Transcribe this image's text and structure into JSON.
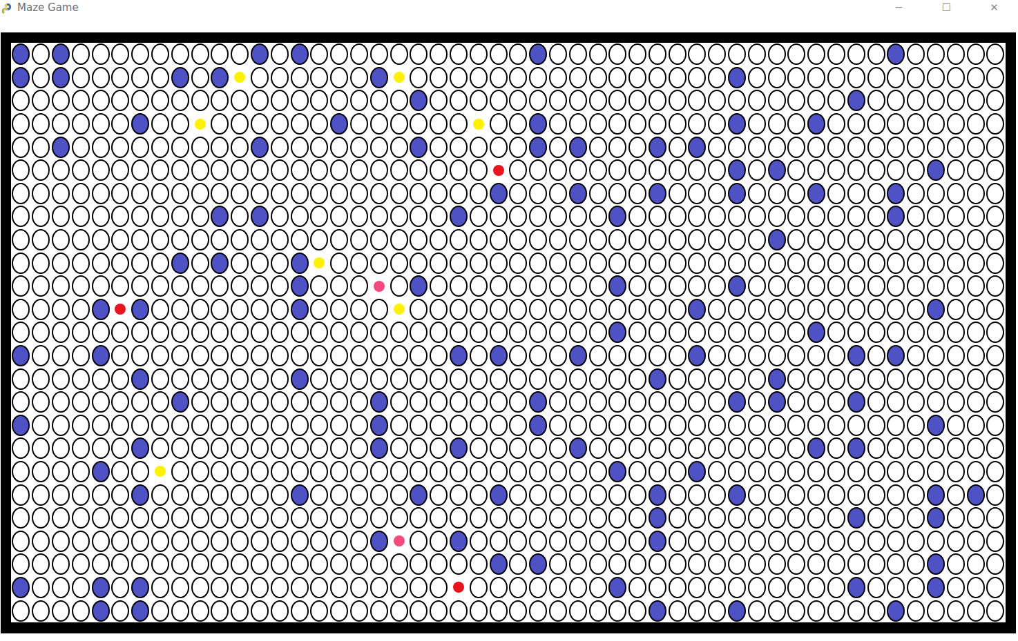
{
  "window": {
    "title": "Maze Game",
    "controls": [
      "─",
      "☐",
      "✕"
    ]
  },
  "grid": {
    "rows": 25,
    "columns": 50
  },
  "walls": [
    [
      0,
      0
    ],
    [
      0,
      2
    ],
    [
      0,
      12
    ],
    [
      0,
      14
    ],
    [
      0,
      26
    ],
    [
      0,
      44
    ],
    [
      1,
      0
    ],
    [
      1,
      2
    ],
    [
      1,
      8
    ],
    [
      1,
      10
    ],
    [
      1,
      18
    ],
    [
      1,
      36
    ],
    [
      2,
      20
    ],
    [
      2,
      42
    ],
    [
      3,
      6
    ],
    [
      3,
      16
    ],
    [
      3,
      26
    ],
    [
      3,
      36
    ],
    [
      3,
      40
    ],
    [
      4,
      2
    ],
    [
      4,
      12
    ],
    [
      4,
      20
    ],
    [
      4,
      26
    ],
    [
      4,
      28
    ],
    [
      4,
      32
    ],
    [
      4,
      34
    ],
    [
      5,
      36
    ],
    [
      5,
      38
    ],
    [
      5,
      46
    ],
    [
      6,
      24
    ],
    [
      6,
      28
    ],
    [
      6,
      32
    ],
    [
      6,
      36
    ],
    [
      6,
      40
    ],
    [
      6,
      44
    ],
    [
      7,
      10
    ],
    [
      7,
      12
    ],
    [
      7,
      22
    ],
    [
      7,
      30
    ],
    [
      7,
      44
    ],
    [
      8,
      38
    ],
    [
      9,
      8
    ],
    [
      9,
      10
    ],
    [
      9,
      14
    ],
    [
      10,
      14
    ],
    [
      10,
      20
    ],
    [
      10,
      30
    ],
    [
      10,
      36
    ],
    [
      11,
      4
    ],
    [
      11,
      6
    ],
    [
      11,
      14
    ],
    [
      11,
      34
    ],
    [
      11,
      46
    ],
    [
      12,
      30
    ],
    [
      12,
      40
    ],
    [
      13,
      0
    ],
    [
      13,
      4
    ],
    [
      13,
      22
    ],
    [
      13,
      24
    ],
    [
      13,
      28
    ],
    [
      13,
      34
    ],
    [
      13,
      42
    ],
    [
      13,
      44
    ],
    [
      14,
      6
    ],
    [
      14,
      14
    ],
    [
      14,
      32
    ],
    [
      14,
      38
    ],
    [
      15,
      8
    ],
    [
      15,
      18
    ],
    [
      15,
      26
    ],
    [
      15,
      36
    ],
    [
      15,
      38
    ],
    [
      15,
      42
    ],
    [
      16,
      0
    ],
    [
      16,
      18
    ],
    [
      16,
      26
    ],
    [
      16,
      46
    ],
    [
      17,
      6
    ],
    [
      17,
      18
    ],
    [
      17,
      22
    ],
    [
      17,
      28
    ],
    [
      17,
      40
    ],
    [
      17,
      42
    ],
    [
      18,
      4
    ],
    [
      18,
      30
    ],
    [
      18,
      34
    ],
    [
      19,
      6
    ],
    [
      19,
      14
    ],
    [
      19,
      20
    ],
    [
      19,
      24
    ],
    [
      19,
      32
    ],
    [
      19,
      36
    ],
    [
      19,
      46
    ],
    [
      19,
      48
    ],
    [
      20,
      32
    ],
    [
      20,
      42
    ],
    [
      20,
      46
    ],
    [
      21,
      18
    ],
    [
      21,
      22
    ],
    [
      21,
      32
    ],
    [
      22,
      24
    ],
    [
      22,
      26
    ],
    [
      22,
      46
    ],
    [
      23,
      0
    ],
    [
      23,
      4
    ],
    [
      23,
      6
    ],
    [
      23,
      30
    ],
    [
      23,
      42
    ],
    [
      23,
      46
    ],
    [
      24,
      4
    ],
    [
      24,
      6
    ],
    [
      24,
      32
    ],
    [
      24,
      36
    ],
    [
      24,
      44
    ]
  ],
  "pickups": [
    {
      "row": 1,
      "col": 11,
      "color": "#fff200"
    },
    {
      "row": 1,
      "col": 19,
      "color": "#fff200"
    },
    {
      "row": 3,
      "col": 9,
      "color": "#fff200"
    },
    {
      "row": 3,
      "col": 23,
      "color": "#fff200"
    },
    {
      "row": 5,
      "col": 24,
      "color": "#e8141e"
    },
    {
      "row": 9,
      "col": 15,
      "color": "#fff200"
    },
    {
      "row": 10,
      "col": 18,
      "color": "#f24b7c"
    },
    {
      "row": 11,
      "col": 5,
      "color": "#e8141e"
    },
    {
      "row": 11,
      "col": 19,
      "color": "#fff200"
    },
    {
      "row": 18,
      "col": 7,
      "color": "#fff200"
    },
    {
      "row": 21,
      "col": 19,
      "color": "#f24b7c"
    },
    {
      "row": 23,
      "col": 22,
      "color": "#e8141e"
    }
  ]
}
